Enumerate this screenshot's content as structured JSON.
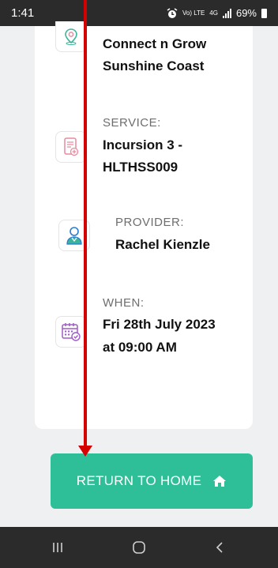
{
  "status_bar": {
    "time": "1:41",
    "network_label_top": "Vo) LTE",
    "network_label_gen": "4G",
    "battery": "69%"
  },
  "details": {
    "location": {
      "line1": "Connect n Grow",
      "line2": "Sunshine Coast"
    },
    "service": {
      "label": "SERVICE:",
      "line1": "Incursion 3 -",
      "line2": "HLTHSS009"
    },
    "provider": {
      "label": "PROVIDER:",
      "name": "Rachel Kienzle"
    },
    "when": {
      "label": "WHEN:",
      "line1": "Fri 28th July 2023",
      "line2": "at 09:00 AM"
    }
  },
  "actions": {
    "return_home_label": "RETURN TO HOME"
  },
  "nav": {
    "icons": [
      "recent-apps-icon",
      "home-nav-icon",
      "back-icon"
    ]
  },
  "colors": {
    "accent": "#2fbf98",
    "annotation_red": "#d50000",
    "icon_purple": "#a05cc6",
    "icon_pink": "#e98a9e",
    "icon_teal": "#3bb59a"
  }
}
